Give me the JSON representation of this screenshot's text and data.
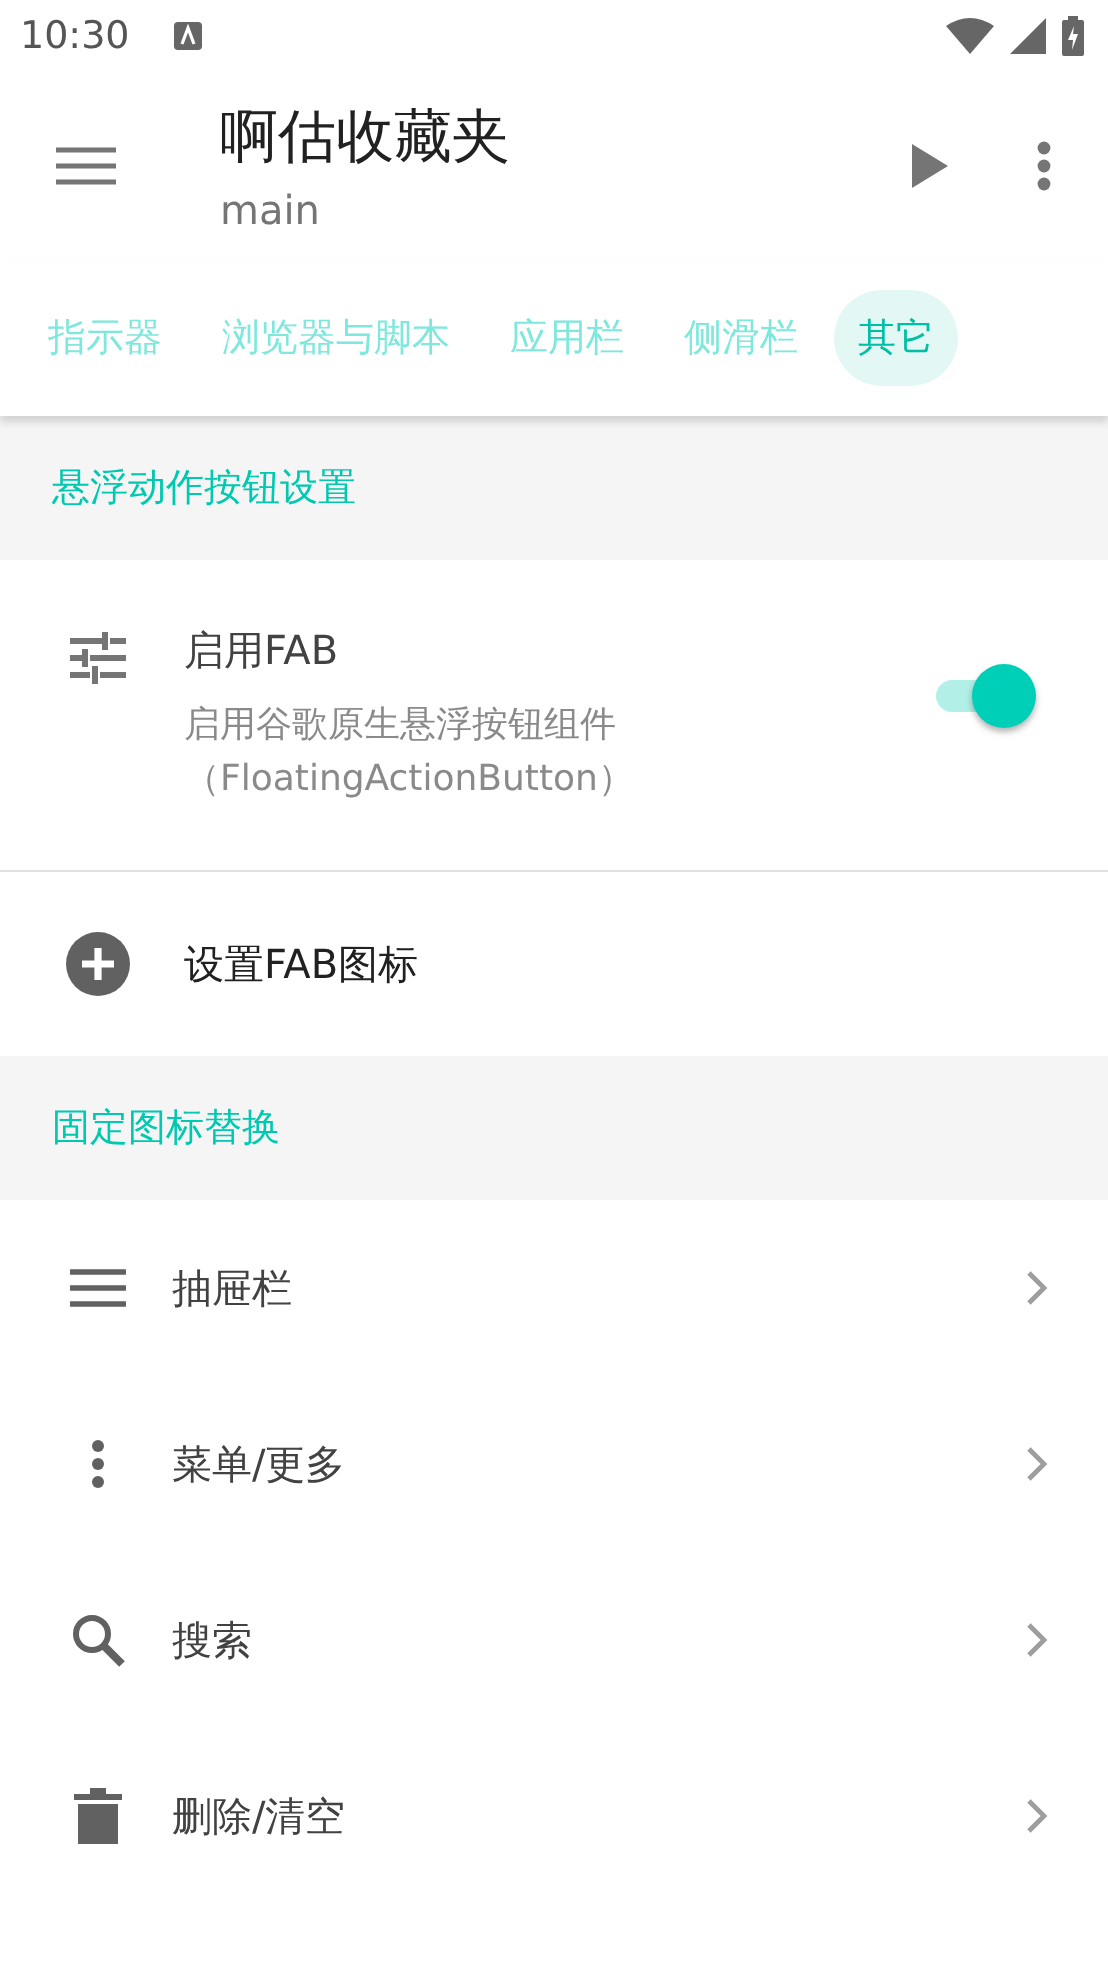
{
  "status_bar": {
    "time": "10:30"
  },
  "toolbar": {
    "title": "啊估收藏夹",
    "subtitle": "main"
  },
  "tabs": [
    {
      "label": "指示器",
      "selected": false
    },
    {
      "label": "浏览器与脚本",
      "selected": false
    },
    {
      "label": "应用栏",
      "selected": false
    },
    {
      "label": "侧滑栏",
      "selected": false
    },
    {
      "label": "其它",
      "selected": true
    }
  ],
  "sections": [
    {
      "title": "悬浮动作按钮设置",
      "items": [
        {
          "kind": "switch",
          "title": "启用FAB",
          "summary": "启用谷歌原生悬浮按钮组件（FloatingActionButton）",
          "on": true
        },
        {
          "kind": "action",
          "title": "设置FAB图标"
        }
      ]
    },
    {
      "title": "固定图标替换",
      "items": [
        {
          "kind": "link",
          "title": "抽屉栏"
        },
        {
          "kind": "link",
          "title": "菜单/更多"
        },
        {
          "kind": "link",
          "title": "搜索"
        },
        {
          "kind": "link",
          "title": "删除/清空"
        }
      ]
    }
  ]
}
